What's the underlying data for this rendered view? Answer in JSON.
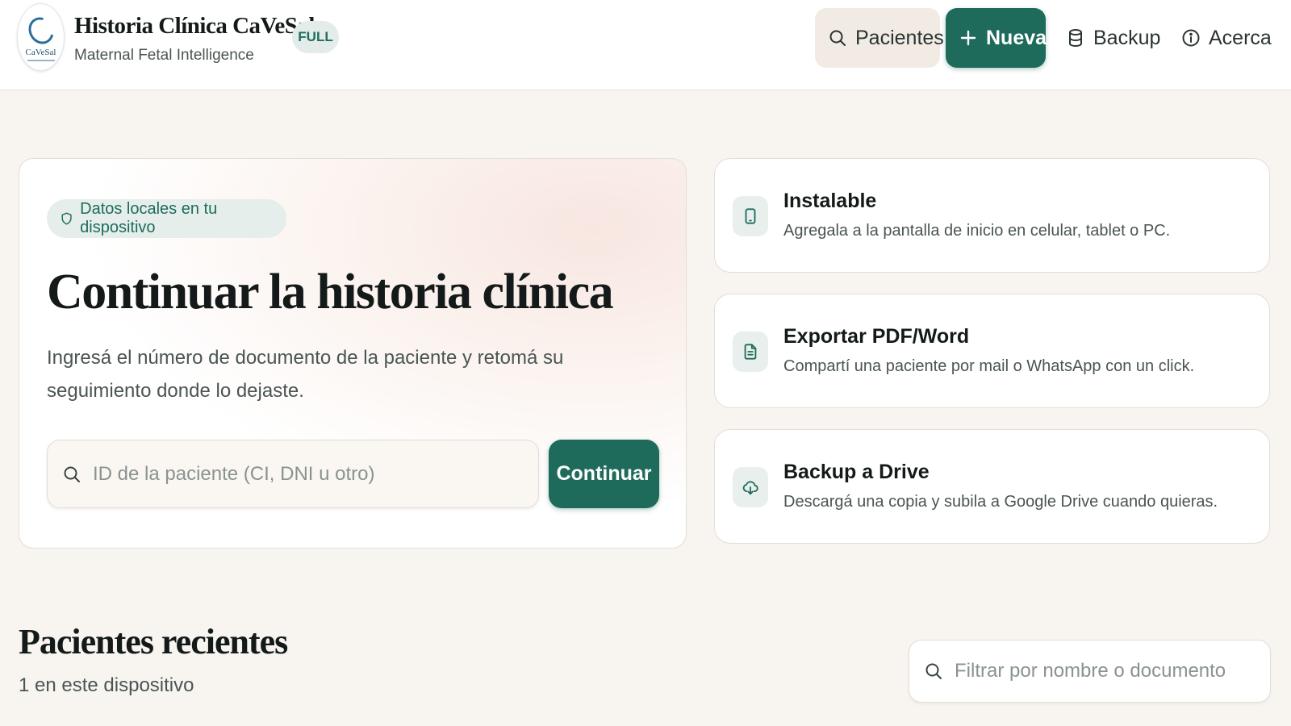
{
  "header": {
    "logo_text": "CaVeSal",
    "brand_title": "Historia Clínica CaVeSal",
    "brand_subtitle": "Maternal Fetal Intelligence",
    "plan_badge": "FULL",
    "nav": {
      "pacientes": "Pacientes",
      "nueva": "Nueva",
      "backup": "Backup",
      "acerca": "Acerca"
    }
  },
  "hero": {
    "chip": "Datos locales en tu dispositivo",
    "title": "Continuar la historia clínica",
    "description": "Ingresá el número de documento de la paciente y retomá su seguimiento donde lo dejaste.",
    "input_placeholder": "ID de la paciente (CI, DNI u otro)",
    "input_value": "",
    "continue_label": "Continuar"
  },
  "features": [
    {
      "icon": "phone-icon",
      "title": "Instalable",
      "description": "Agregala a la pantalla de inicio en celular, tablet o PC."
    },
    {
      "icon": "document-icon",
      "title": "Exportar PDF/Word",
      "description": "Compartí una paciente por mail o WhatsApp con un click."
    },
    {
      "icon": "cloud-download-icon",
      "title": "Backup a Drive",
      "description": "Descargá una copia y subila a Google Drive cuando quieras."
    }
  ],
  "recent": {
    "title": "Pacientes recientes",
    "count_text": "1 en este dispositivo",
    "filter_placeholder": "Filtrar por nombre o documento",
    "filter_value": ""
  },
  "colors": {
    "accent": "#1e6b5c",
    "background": "#f8f5f0",
    "chip_bg": "#e5eeea"
  }
}
